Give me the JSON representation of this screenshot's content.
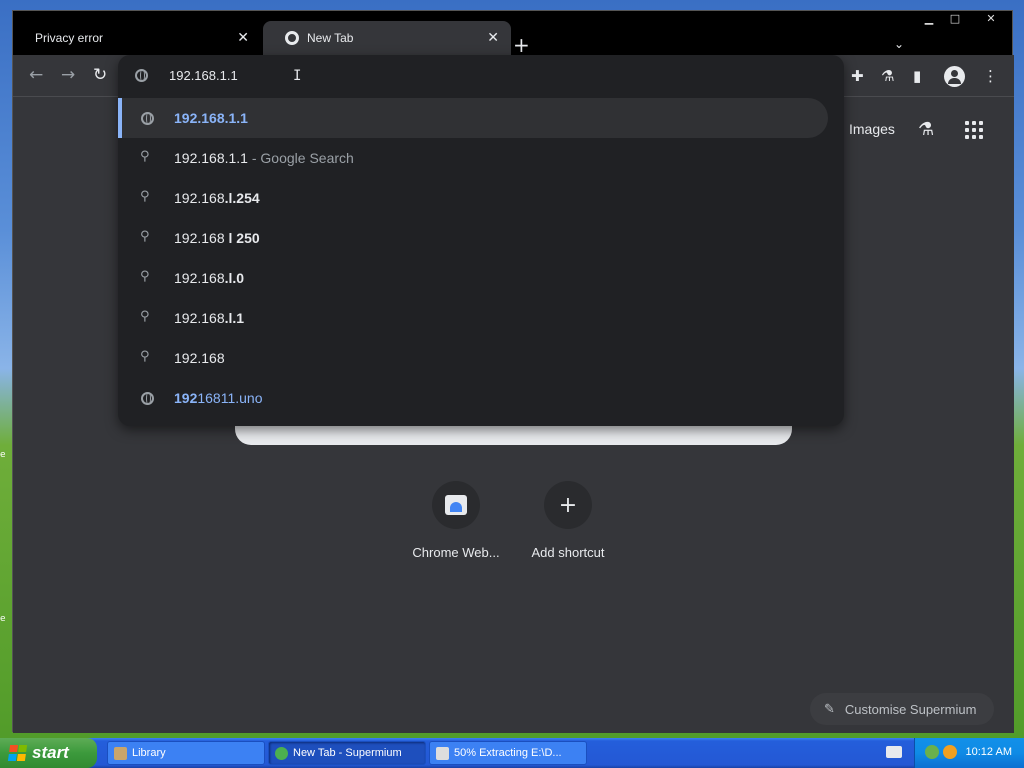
{
  "desktop": {
    "left_label_1": "e",
    "left_label_2": "e"
  },
  "window_controls": {
    "minimize": "▁",
    "maximize": "□",
    "close": "✕"
  },
  "tabs": [
    {
      "title": "Privacy error",
      "close": "✕"
    },
    {
      "title": "New Tab",
      "close": "✕"
    }
  ],
  "new_tab": "+",
  "tab_search": "⌄",
  "toolbar": {
    "back": "←",
    "forward": "→",
    "reload": "↻",
    "menu": "⋮"
  },
  "omnibox": {
    "text": "192.168.1.1",
    "caret": "I",
    "suggestions": [
      {
        "type": "url",
        "bold": "192.168.1.1",
        "rest": ""
      },
      {
        "type": "search",
        "bold": "",
        "rest": "192.168.1.1",
        "suffix": " - Google Search"
      },
      {
        "type": "search",
        "plain": "192.168",
        "bold": ".l.254"
      },
      {
        "type": "search",
        "plain": "192.168",
        "bold": " l 250"
      },
      {
        "type": "search",
        "plain": "192.168",
        "bold": ".l.0"
      },
      {
        "type": "search",
        "plain": "192.168",
        "bold": ".l.1"
      },
      {
        "type": "search",
        "plain": "192.168",
        "bold": ""
      },
      {
        "type": "url",
        "bold": "192",
        "rest": "16811.uno"
      }
    ]
  },
  "ntp": {
    "images_link": "Images",
    "labs_icon": "⚗",
    "shortcuts": [
      {
        "label": "Chrome Web..."
      },
      {
        "label": "Add shortcut",
        "glyph": "+"
      }
    ],
    "customise_label": "Customise Supermium",
    "customise_icon": "✎"
  },
  "taskbar": {
    "start_label": "start",
    "items": [
      {
        "label": "Library"
      },
      {
        "label": "New Tab - Supermium"
      },
      {
        "label": "50% Extracting E:\\D..."
      }
    ],
    "clock": "10:12 AM"
  },
  "colors": {
    "chrome_dark": "#35363a",
    "omnibox_bg": "#202124",
    "link_blue": "#8ab4f8",
    "xp_taskbar": "#245edb",
    "xp_start": "#3c9a3c"
  }
}
